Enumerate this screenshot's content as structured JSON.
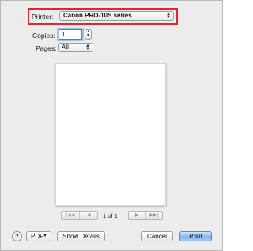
{
  "printer": {
    "label": "Printer:",
    "selected": "Canon PRO-10S series"
  },
  "copies": {
    "label": "Copies:",
    "value": "1"
  },
  "pages": {
    "label": "Pages:",
    "selected": "All"
  },
  "preview": {
    "page_indicator": "1 of 1"
  },
  "nav": {
    "first": "|◀◀",
    "prev": "◀",
    "next": "▶",
    "last": "▶▶|"
  },
  "footer": {
    "help": "?",
    "pdf": "PDF",
    "show_details": "Show Details",
    "cancel": "Cancel",
    "print": "Print"
  },
  "colors": {
    "highlight": "#e0262b",
    "primary_button": "#86b4ef"
  }
}
